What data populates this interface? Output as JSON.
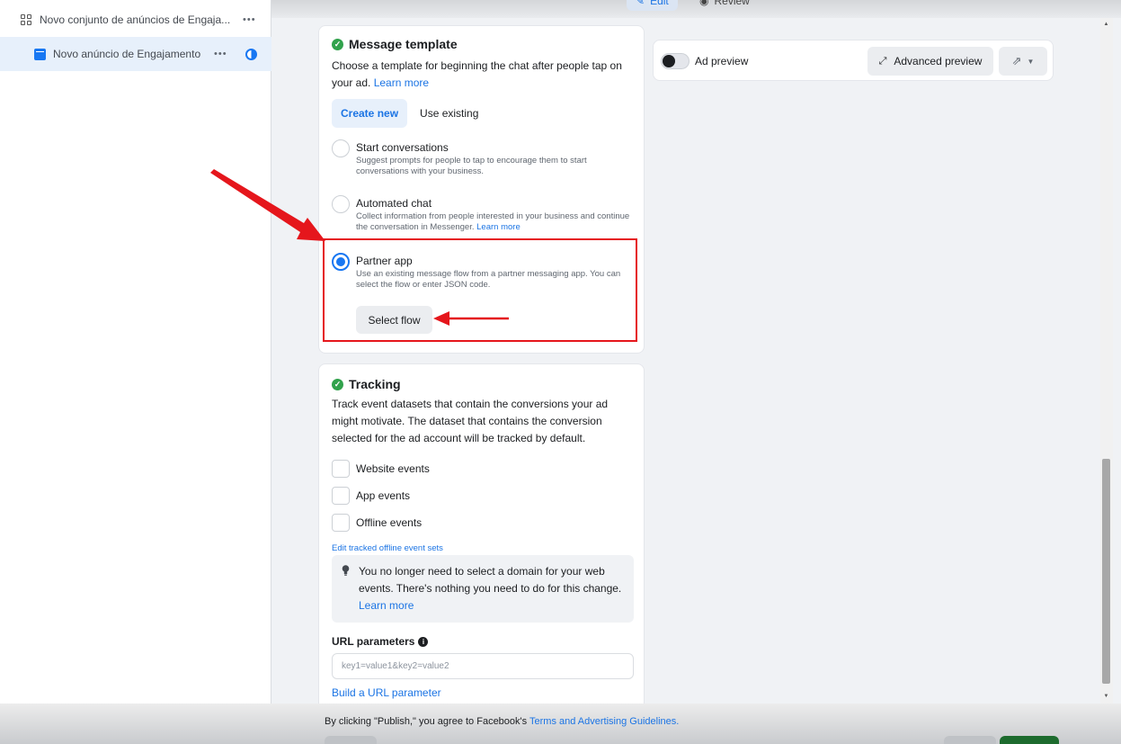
{
  "topbar": {
    "edit_label": "Edit",
    "review_label": "Review"
  },
  "sidebar": {
    "ad_set_name": "Novo conjunto de anúncios de Engaja...",
    "ad_name": "Novo anúncio de Engajamento",
    "more_label": "•••"
  },
  "message_template": {
    "title": "Message template",
    "description": "Choose a template for beginning the chat after people tap on your ad.",
    "learn_more": "Learn more",
    "tabs": {
      "create_new": "Create new",
      "use_existing": "Use existing"
    },
    "options": [
      {
        "title": "Start conversations",
        "subtitle": "Suggest prompts for people to tap to encourage them to start conversations with your business.",
        "selected": false
      },
      {
        "title": "Automated chat",
        "subtitle": "Collect information from people interested in your business and continue the conversation in Messenger.",
        "link": "Learn more",
        "selected": false
      },
      {
        "title": "Partner app",
        "subtitle": "Use an existing message flow from a partner messaging app. You can select the flow or enter JSON code.",
        "selected": true
      }
    ],
    "select_flow_label": "Select flow"
  },
  "tracking": {
    "title": "Tracking",
    "description": "Track event datasets that contain the conversions your ad might motivate. The dataset that contains the conversion selected for the ad account will be tracked by default.",
    "checkboxes": [
      "Website events",
      "App events",
      "Offline events"
    ],
    "edit_offline_link": "Edit tracked offline event sets",
    "info_text": "You no longer need to select a domain for your web events. There's nothing you need to do for this change.",
    "info_link": "Learn more",
    "url_params_label": "URL parameters",
    "url_params_placeholder": "key1=value1&key2=value2",
    "build_url_link": "Build a URL parameter"
  },
  "preview": {
    "toggle_label": "Ad preview",
    "advanced_label": "Advanced preview"
  },
  "footer": {
    "legal_prefix": "By clicking \"Publish,\" you agree to Facebook's",
    "legal_link": "Terms and Advertising Guidelines."
  },
  "colors": {
    "accent": "#1877f2",
    "success": "#31a24c",
    "highlight": "#e5161c"
  }
}
